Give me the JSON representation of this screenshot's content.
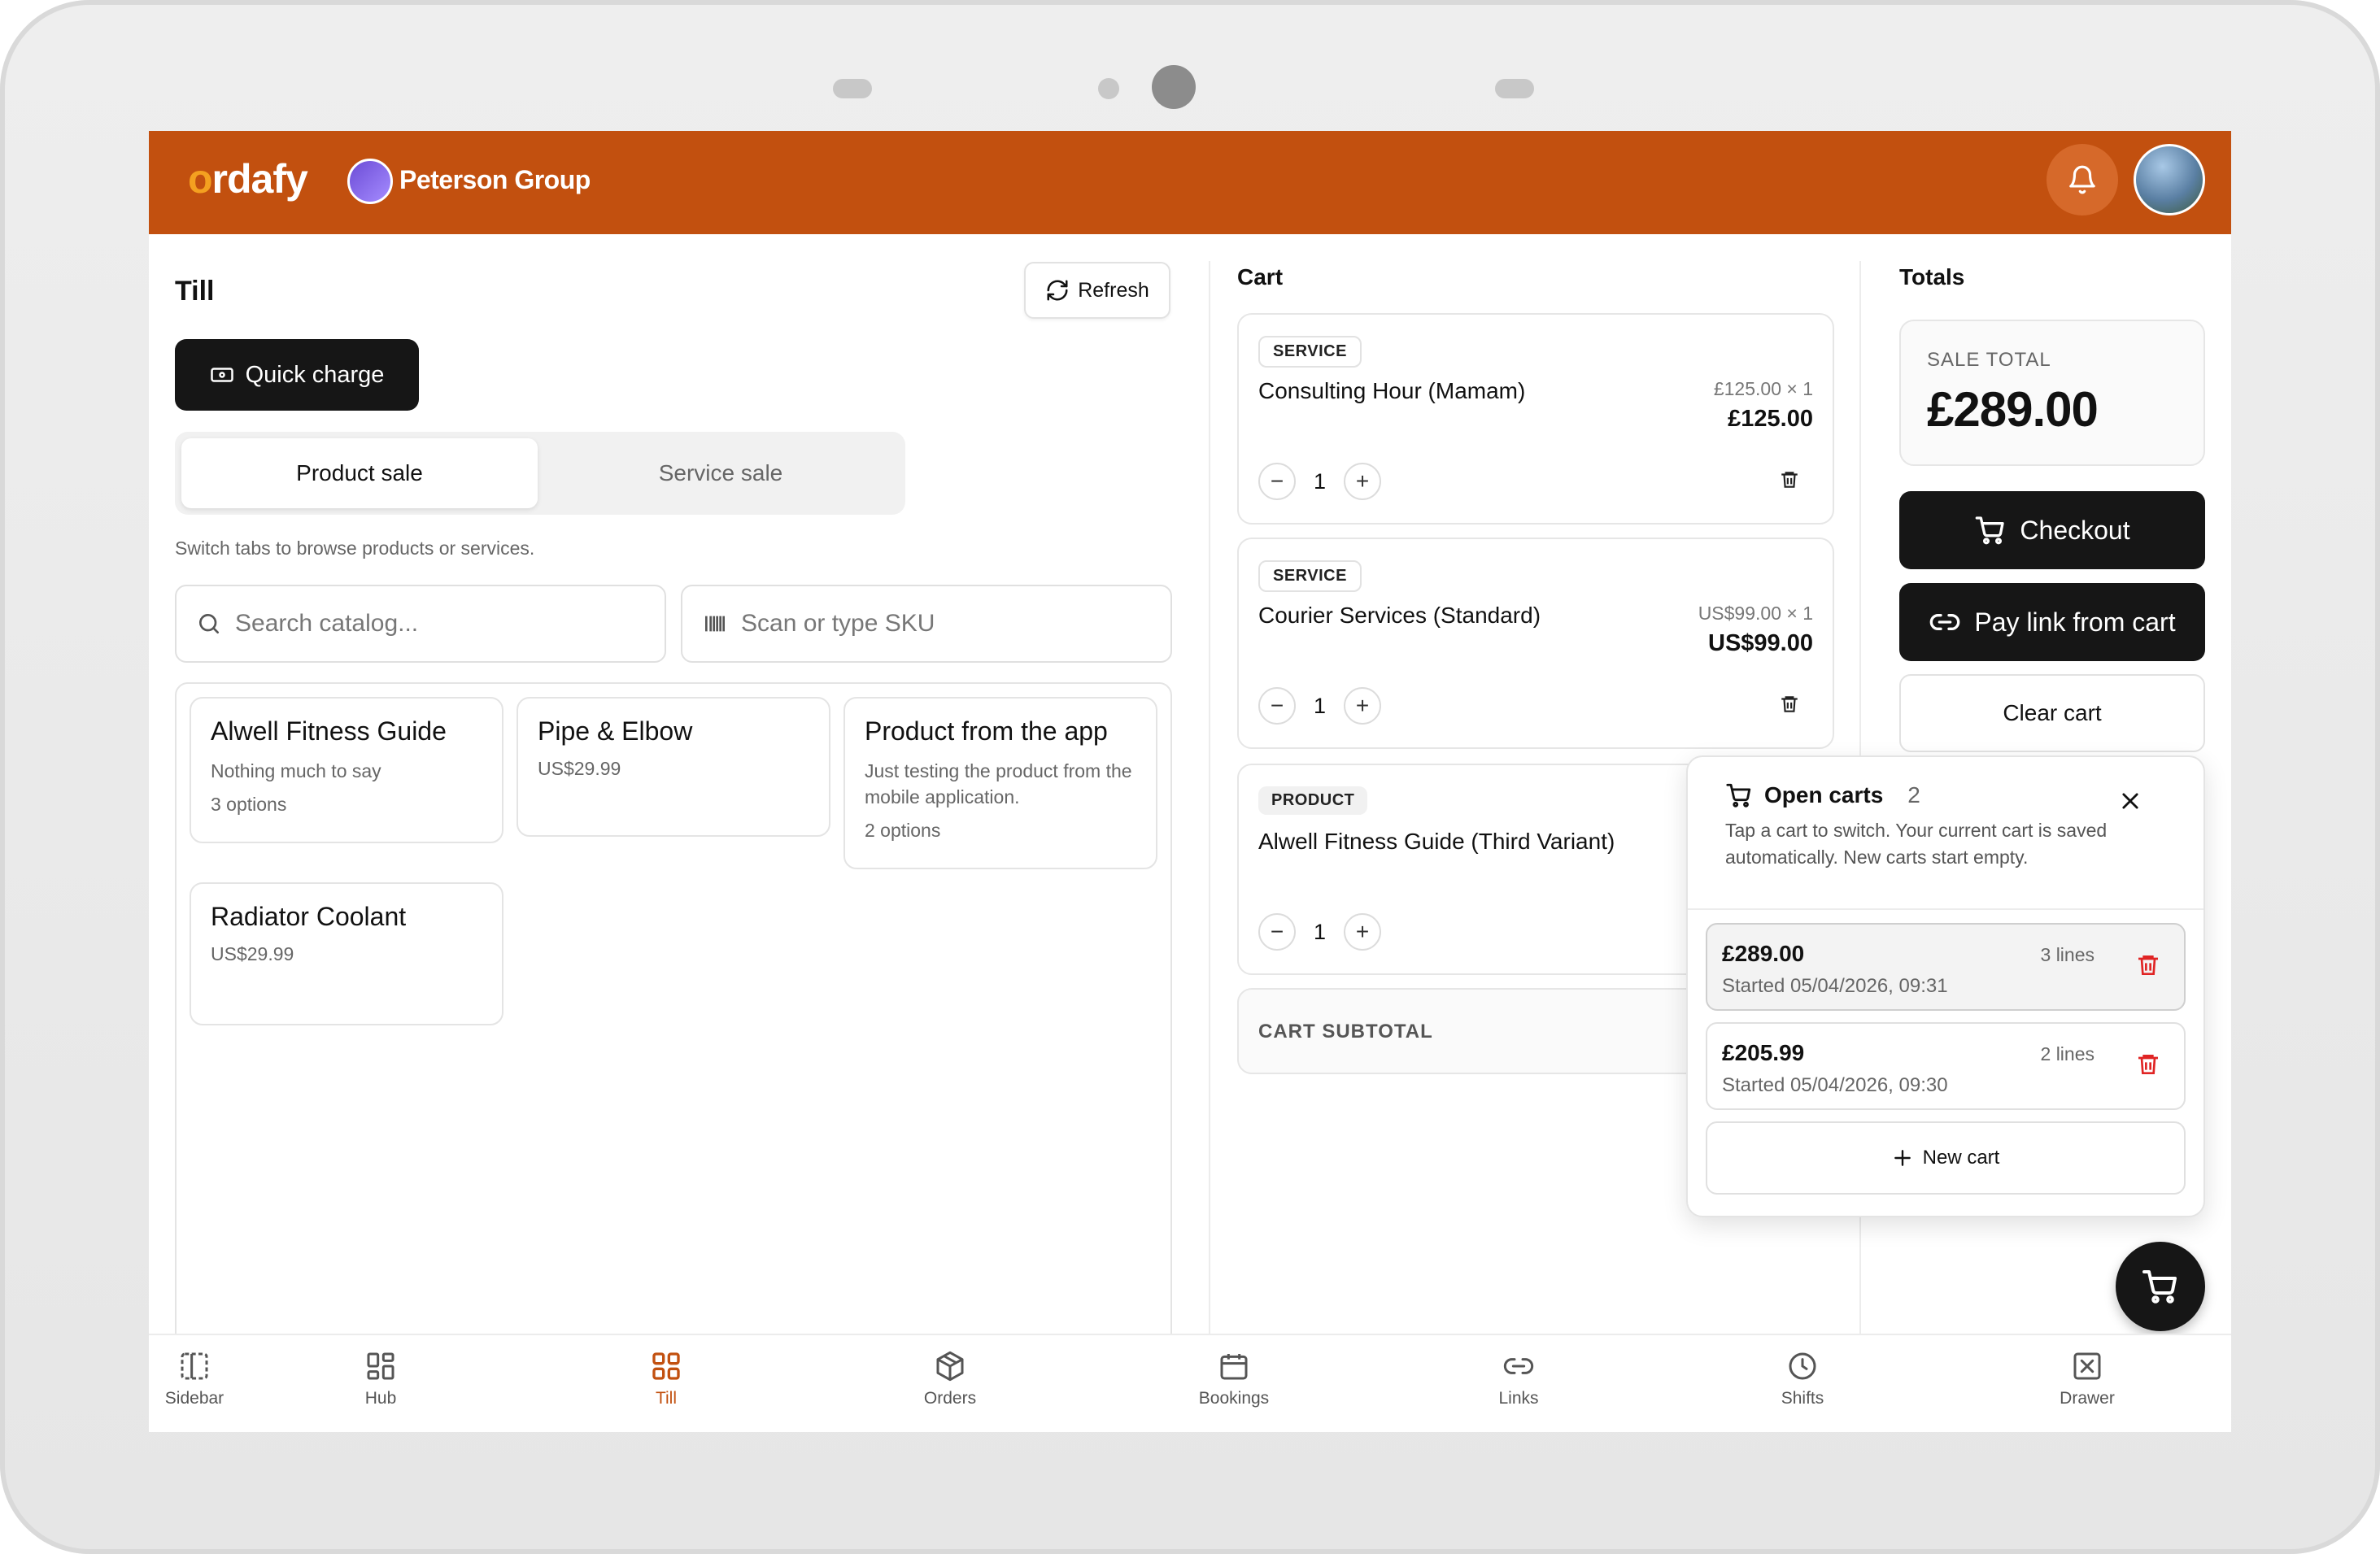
{
  "app": {
    "logo_text": "rdafy",
    "logo_letter": "o",
    "org_name": "Peterson Group"
  },
  "colors": {
    "brand": "#c2500f",
    "dark_button": "#161616",
    "danger": "#e02424"
  },
  "till": {
    "title": "Till",
    "refresh_label": "Refresh",
    "quick_charge_label": "Quick charge",
    "tabs": [
      {
        "label": "Product sale",
        "active": true
      },
      {
        "label": "Service sale",
        "active": false
      }
    ],
    "hint": "Switch tabs to browse products or services.",
    "search_placeholder": "Search catalog...",
    "sku_placeholder": "Scan or type SKU",
    "products": [
      {
        "name": "Alwell Fitness Guide",
        "description": "Nothing much to say",
        "meta": "3 options"
      },
      {
        "name": "Pipe & Elbow",
        "description": "",
        "meta": "US$29.99"
      },
      {
        "name": "Product from the app",
        "description": "Just testing the product from the mobile application.",
        "meta": "2 options"
      },
      {
        "name": "Radiator Coolant",
        "description": "",
        "meta": "US$29.99"
      }
    ]
  },
  "cart": {
    "title": "Cart",
    "items": [
      {
        "type": "SERVICE",
        "name": "Consulting Hour (Mamam)",
        "unit": "£125.00 × 1",
        "total": "£125.00",
        "qty": "1"
      },
      {
        "type": "SERVICE",
        "name": "Courier Services (Standard)",
        "unit": "US$99.00 × 1",
        "total": "US$99.00",
        "qty": "1"
      },
      {
        "type": "PRODUCT",
        "name": "Alwell Fitness Guide (Third Variant)",
        "unit": "",
        "total": "",
        "qty": "1"
      }
    ],
    "subtotal_label": "CART SUBTOTAL",
    "minus": "−",
    "plus": "+"
  },
  "totals": {
    "title": "Totals",
    "sale_total_label": "SALE TOTAL",
    "sale_total": "£289.00",
    "checkout_label": "Checkout",
    "pay_link_label": "Pay link from cart",
    "clear_cart_label": "Clear cart"
  },
  "open_carts": {
    "title": "Open carts",
    "count": "2",
    "description": "Tap a cart to switch. Your current cart is saved automatically. New carts start empty.",
    "carts": [
      {
        "amount": "£289.00",
        "lines": "3 lines",
        "started": "Started 05/04/2026, 09:31",
        "current": true
      },
      {
        "amount": "£205.99",
        "lines": "2 lines",
        "started": "Started 05/04/2026, 09:30",
        "current": false
      }
    ],
    "new_cart_label": "New cart"
  },
  "nav": [
    {
      "label": "Sidebar",
      "icon": "sidebar-icon",
      "active": false
    },
    {
      "label": "Hub",
      "icon": "grid-icon",
      "active": false
    },
    {
      "label": "Till",
      "icon": "grid-icon",
      "active": true
    },
    {
      "label": "Orders",
      "icon": "box-icon",
      "active": false
    },
    {
      "label": "Bookings",
      "icon": "calendar-icon",
      "active": false
    },
    {
      "label": "Links",
      "icon": "link-icon",
      "active": false
    },
    {
      "label": "Shifts",
      "icon": "clock-icon",
      "active": false
    },
    {
      "label": "Drawer",
      "icon": "drawer-icon",
      "active": false
    }
  ]
}
